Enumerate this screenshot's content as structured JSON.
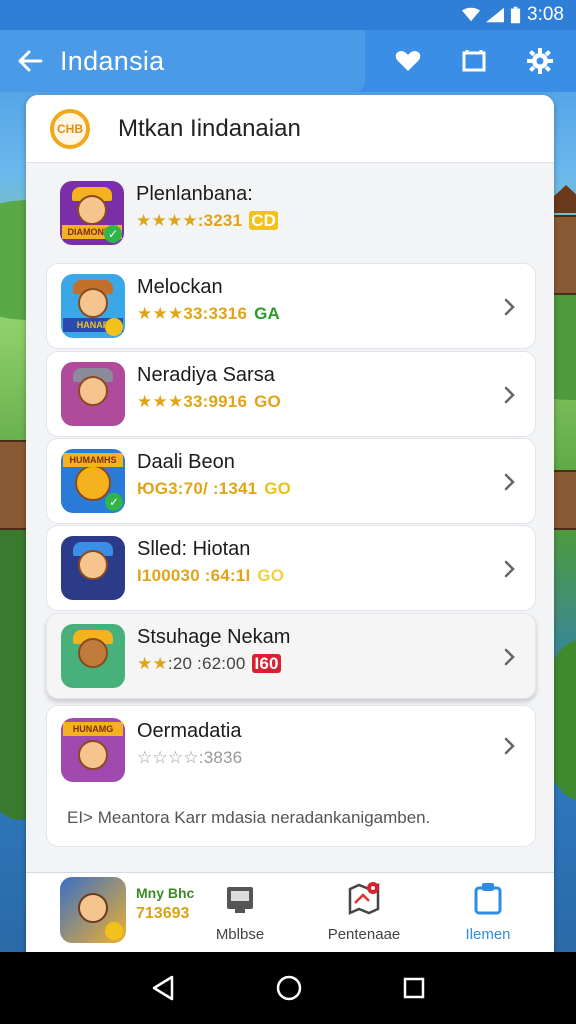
{
  "status_bar": {
    "time": "3:08"
  },
  "app_bar": {
    "title": "Indansia"
  },
  "panel": {
    "title": "Mtkan Iindanaian",
    "icon_text": "CHB"
  },
  "games": [
    {
      "name": "Plenlanbana:",
      "rating_text": ":3231",
      "tag": "CD",
      "tag_color": "#e0a41a",
      "stars": "★★★★",
      "thumb_bg": "#7a2fa8",
      "thumb_banner": "DIAMONDS"
    },
    {
      "name": "Melockan",
      "rating_text": "33:3316",
      "tag": "GA",
      "tag_color": "#2c9a2c",
      "stars": "★★★",
      "thumb_bg": "#3aa8e8",
      "thumb_banner": "HANAR"
    },
    {
      "name": "Neradiya Sarsa",
      "rating_text": "33:9916",
      "tag": "GO",
      "tag_color": "#e0a41a",
      "stars": "★★★",
      "thumb_bg": "#b04a9a",
      "thumb_banner": ""
    },
    {
      "name": "Daali Beon",
      "rating_text": "ЮG3:70/ :1341",
      "tag": "GO",
      "tag_color": "#e8c21a",
      "stars": "",
      "thumb_bg": "#2a7ad8",
      "thumb_banner": "HUMAMHS"
    },
    {
      "name": "Slled: Hiotan",
      "rating_text": "I100030 :64:1I",
      "tag": "GO",
      "tag_color": "#f0d040",
      "stars": "",
      "thumb_bg": "#2c3a8a",
      "thumb_banner": ""
    },
    {
      "name": "Stsuhage Nekam",
      "rating_text": ":20 :62:00",
      "tag": "I60",
      "tag_color": "#d82030",
      "stars": "★★",
      "thumb_bg": "#48b07a",
      "thumb_banner": ""
    },
    {
      "name": "Oermadatia",
      "rating_text": ":3836",
      "tag": "",
      "tag_color": "#999999",
      "stars": "☆☆☆☆",
      "thumb_bg": "#a04ab0",
      "thumb_banner": "HUNAMG"
    }
  ],
  "description": "EI> Meantora Karr mdasia neradankanigamben.",
  "bottom_nav": {
    "featured_line1": "Mny Bhc",
    "featured_line2": "713693",
    "tabs": [
      {
        "label": "Mblbse",
        "icon": "briefcase-icon"
      },
      {
        "label": "Pentenaae",
        "icon": "map-icon"
      },
      {
        "label": "Ilemen",
        "icon": "clipboard-icon"
      }
    ]
  },
  "colors": {
    "accent": "#2d8de0",
    "appbar": "#3a8ee6",
    "star": "#e0a41a"
  }
}
